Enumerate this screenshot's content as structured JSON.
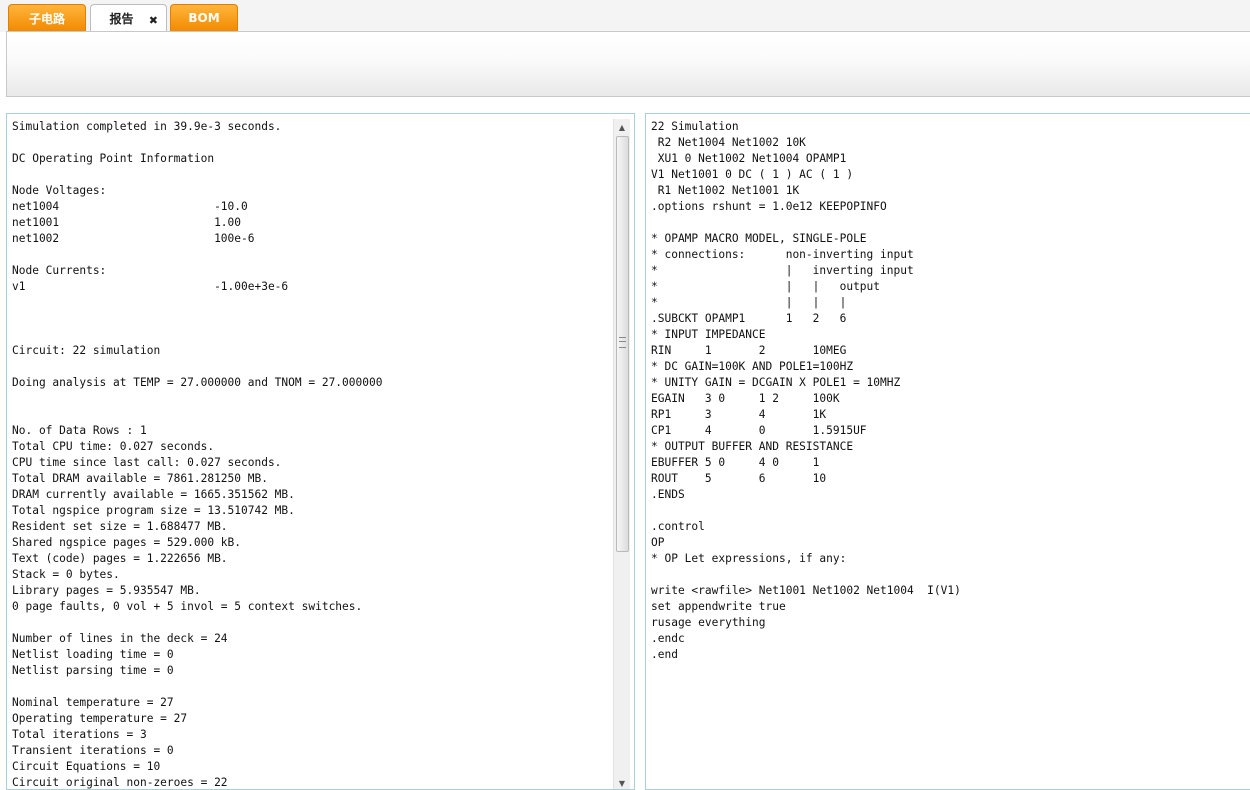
{
  "tabs": [
    {
      "label": "子电路"
    },
    {
      "label": "报告",
      "close": "✖"
    },
    {
      "label": "BOM"
    }
  ],
  "report_output": {
    "lines": [
      "Simulation completed in 39.9e-3 seconds.",
      "",
      "DC Operating Point Information",
      "",
      "Node Voltages:",
      "net1004                       -10.0",
      "net1001                       1.00",
      "net1002                       100e-6",
      "",
      "Node Currents:",
      "v1                            -1.00e+3e-6",
      "",
      "",
      "",
      "Circuit: 22 simulation",
      "",
      "Doing analysis at TEMP = 27.000000 and TNOM = 27.000000",
      "",
      "",
      "No. of Data Rows : 1",
      "Total CPU time: 0.027 seconds.",
      "CPU time since last call: 0.027 seconds.",
      "Total DRAM available = 7861.281250 MB.",
      "DRAM currently available = 1665.351562 MB.",
      "Total ngspice program size = 13.510742 MB.",
      "Resident set size = 1.688477 MB.",
      "Shared ngspice pages = 529.000 kB.",
      "Text (code) pages = 1.222656 MB.",
      "Stack = 0 bytes.",
      "Library pages = 5.935547 MB.",
      "0 page faults, 0 vol + 5 invol = 5 context switches.",
      "",
      "Number of lines in the deck = 24",
      "Netlist loading time = 0",
      "Netlist parsing time = 0",
      "",
      "Nominal temperature = 27",
      "Operating temperature = 27",
      "Total iterations = 3",
      "Transient iterations = 0",
      "Circuit Equations = 10",
      "Circuit original non-zeroes = 22"
    ]
  },
  "netlist": {
    "lines": [
      "22 Simulation",
      " R2 Net1004 Net1002 10K",
      " XU1 0 Net1002 Net1004 OPAMP1",
      "V1 Net1001 0 DC ( 1 ) AC ( 1 )",
      " R1 Net1002 Net1001 1K",
      ".options rshunt = 1.0e12 KEEPOPINFO",
      "",
      "* OPAMP MACRO MODEL, SINGLE-POLE",
      "* connections:      non-inverting input",
      "*                   |   inverting input",
      "*                   |   |   output",
      "*                   |   |   |",
      ".SUBCKT OPAMP1      1   2   6",
      "* INPUT IMPEDANCE",
      "RIN     1       2       10MEG",
      "* DC GAIN=100K AND POLE1=100HZ",
      "* UNITY GAIN = DCGAIN X POLE1 = 10MHZ",
      "EGAIN   3 0     1 2     100K",
      "RP1     3       4       1K",
      "CP1     4       0       1.5915UF",
      "* OUTPUT BUFFER AND RESISTANCE",
      "EBUFFER 5 0     4 0     1",
      "ROUT    5       6       10",
      ".ENDS",
      "",
      ".control",
      "OP",
      "* OP Let expressions, if any:",
      "",
      "write <rawfile> Net1001 Net1002 Net1004  I(V1)",
      "set appendwrite true",
      "rusage everything",
      ".endc",
      ".end"
    ]
  },
  "scrollbar": {
    "up_icon": "▲",
    "down_icon": "▼"
  },
  "colors": {
    "tab_orange": "#f28a00",
    "panel_border": "#a9cfd9"
  }
}
